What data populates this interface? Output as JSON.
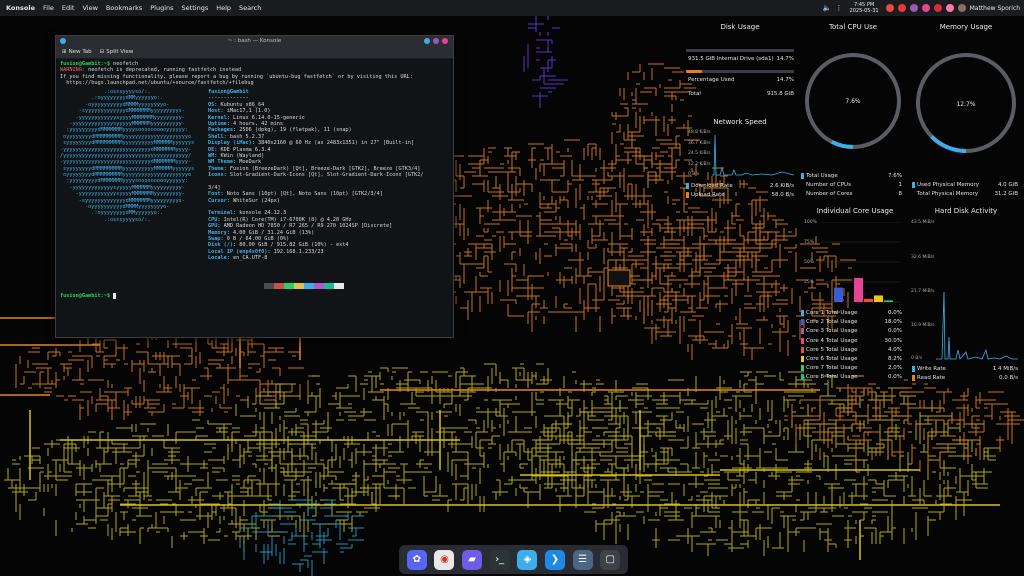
{
  "top_panel": {
    "menu": [
      "Konsole",
      "File",
      "Edit",
      "View",
      "Bookmarks",
      "Plugins",
      "Settings",
      "Help",
      "Search"
    ],
    "time": "7:45 PM",
    "date": "2025-05-31",
    "user": "Matthew Sporich"
  },
  "konsole": {
    "title": "~ : bash — Konsole",
    "new_tab": "New Tab",
    "split_view": "Split View",
    "lines": [
      {
        "cls": "green",
        "text": "fusion@Gambit:~$ ",
        "rest": "neofetch"
      },
      {
        "cls": "warn",
        "text": "WARNING: ",
        "rest": "neofetch is deprecated, running fastfetch instead"
      },
      {
        "cls": "dim",
        "text": "If you find missing functionality, please report a bug by running `ubuntu-bug fastfetch` or by visiting this URL:",
        "rest": ""
      },
      {
        "cls": "dim",
        "text": "  https://bugs.launchpad.net/ubuntu/+source/fastfetch/+filebug",
        "rest": ""
      }
    ],
    "logo": [
      "              .:osssyyyyso/:.",
      "          .:oyyyyyyyydMMyyyyyyo:.",
      "        -oyyyyyyyyyydMMMMyyyyyyyyo-",
      "      -syyyyyyyyyyyyydMMMMMMMyyyyyyyyys-",
      "     -yyyyyyyyyyyysyyyyMMMMMMMyyyyyyyyy-",
      "   -yyyyyyyyyyyyysyyyyyMMMMMMyyyyyyyyyy-",
      "  :yyyyyyyyydMMMMMMMyyyysoooooooooyyyyyy:",
      " oyyyyyyyydMMMMMMMMMyyyyyyyyyyyyyyyyyyyyyo",
      " syyyyyyyydMMMMMMMMMyyyyyyyyyyMMMMMMyyyyyys",
      "-yyyyyyyyyyyyyyyyyyyyyyyyyyyydMMMMMMMyyyy-",
      "/yyyyyyyyyyyyyyyyyyyyyyyyyyyyyyyyyyyyyyyy/",
      "-yyyyyyyyyyyyyyyyyyyyyyyyyyyydMMMMMMMyyyy-",
      " syyyyyyyydMMMMMMMMMyyyyyyyyyyMMMMMMyyyyyys",
      " oyyyyyyyydMMMMMMMMMyyyyyyyyyyyyyyyyyyyyyo",
      "  :yyyyyyyyydMMMMMMMyyyysoooooooooyyyyyy:",
      "   -yyyyyyyyyyyyysyyyyyMMMMMMyyyyyyyyyy-",
      "     -yyyyyyyyyyyysyyyyMMMMMMMyyyyyyyyy-",
      "      -syyyyyyyyyyyyydMMMMMMMyyyyyyyyys-",
      "        -oyyyyyyyyyydMMMMyyyyyyyyo-",
      "          .:oyyyyyyyydMMyyyyyyo:.",
      "              .:osssyyyyso/:."
    ],
    "host_line": "fusion@Gambit",
    "separator": "-------------",
    "info": [
      {
        "k": "OS",
        "v": "Kubuntu x86_64"
      },
      {
        "k": "Host",
        "v": "iMac17,1 (1.0)"
      },
      {
        "k": "Kernel",
        "v": "Linux 6.14.0-15-generic"
      },
      {
        "k": "Uptime",
        "v": "4 hours, 42 mins"
      },
      {
        "k": "Packages",
        "v": "2506 (dpkg), 19 (flatpak), 11 (snap)"
      },
      {
        "k": "Shell",
        "v": "bash 5.2.37"
      },
      {
        "k": "Display (iMac)",
        "v": "3840x2160 @ 60 Hz (as 2483x1351) in 27\" [Built-in]"
      },
      {
        "k": "DE",
        "v": "KDE Plasma 6.3.4"
      },
      {
        "k": "WM",
        "v": "KWin (Wayland)"
      },
      {
        "k": "WM Theme",
        "v": "MoeDark"
      },
      {
        "k": "Theme",
        "v": "Fusion (BreezeDark) [Qt], Breeze-Dark [GTK2], Breeze [GTK3/4]"
      },
      {
        "k": "Icons",
        "v": "Slot-Gradient-Dark-Icons [Qt], Slot-Gradient-Dark-Icons [GTK2/"
      },
      {
        "k": "",
        "v": "3/4]"
      },
      {
        "k": "Font",
        "v": "Noto Sans (10pt) [Qt], Noto Sans (10pt) [GTK2/3/4]"
      },
      {
        "k": "Cursor",
        "v": "WhiteSur (24px)"
      },
      {
        "k": "Terminal",
        "v": "konsole 24.12.3"
      },
      {
        "k": "CPU",
        "v": "Intel(R) Core(TM) i7-6700K (8) @ 4.20 GHz"
      },
      {
        "k": "GPU",
        "v": "AMD Radeon HD 7850 / R7 265 / R9 270 1024SP [Discrete]"
      },
      {
        "k": "Memory",
        "v": "4.00 GiB / 31.24 GiB (13%)"
      },
      {
        "k": "Swap",
        "v": "0 B / 64.00 GiB (0%)"
      },
      {
        "k": "Disk (/)",
        "v": "80.00 GiB / 915.82 GiB (10%) - ext4"
      },
      {
        "k": "Local IP (enp4s0f0)",
        "v": "192.168.1.233/23"
      },
      {
        "k": "Locale",
        "v": "en_CA.UTF-8"
      }
    ],
    "prompt": "fusion@Gambit:~$ ",
    "swatch_colors": [
      "#4d4d4d",
      "#c94f4f",
      "#2ecc71",
      "#e0c050",
      "#3daee9",
      "#b05cc6",
      "#1abc9c",
      "#e8e8e8"
    ]
  },
  "widgets": {
    "disk_usage": {
      "title": "Disk Usage",
      "rows": [
        {
          "label": "931.5 GiB Internal Drive (sda1)",
          "value": "14.7%"
        },
        {
          "label": "Percentage Used",
          "value": "14.7%"
        },
        {
          "label": "Total",
          "value": "915.8 GiB"
        }
      ],
      "fraction": 0.147
    },
    "network": {
      "title": "Network Speed",
      "axis": [
        "48.8 KiB/s",
        "36.7 KiB/s",
        "24.5 KiB/s",
        "12.2 KiB/s",
        "0 B/s"
      ],
      "download_label": "Download Rate",
      "download_value": "2.6 KiB/s",
      "upload_label": "Upload Rate",
      "upload_value": "58.0 B/s"
    },
    "cpu": {
      "title": "Total CPU Use",
      "value_text": "7.6%",
      "fraction": 0.076,
      "rows": [
        {
          "label": "Total Usage",
          "value": "7.6%"
        },
        {
          "label": "Number of CPUs",
          "value": "1"
        },
        {
          "label": "Number of Cores",
          "value": "8"
        }
      ]
    },
    "memory": {
      "title": "Memory Usage",
      "value_text": "12.7%",
      "fraction": 0.127,
      "rows": [
        {
          "label": "Used Physical Memory",
          "value": "4.0 GiB"
        },
        {
          "label": "Total Physical Memory",
          "value": "31.2 GiB"
        }
      ]
    },
    "cores": {
      "title": "Individual Core Usage",
      "axis": [
        "100%",
        "75%",
        "50%",
        "25%"
      ],
      "items": [
        {
          "label": "Core 1 Total Usage",
          "value": "0.0%",
          "color": "#3daee9",
          "pct": 0
        },
        {
          "label": "Core 2 Total Usage",
          "value": "18.0%",
          "color": "#3b5bdb",
          "pct": 18
        },
        {
          "label": "Core 3 Total Usage",
          "value": "0.0%",
          "color": "#9b59b6",
          "pct": 0
        },
        {
          "label": "Core 4 Total Usage",
          "value": "30.0%",
          "color": "#e84393",
          "pct": 30
        },
        {
          "label": "Core 5 Total Usage",
          "value": "4.0%",
          "color": "#e74c3c",
          "pct": 4
        },
        {
          "label": "Core 6 Total Usage",
          "value": "8.2%",
          "color": "#f1c40f",
          "pct": 8.2
        },
        {
          "label": "Core 7 Total Usage",
          "value": "2.0%",
          "color": "#2ecc71",
          "pct": 2
        },
        {
          "label": "Core 8 Total Usage",
          "value": "0.0%",
          "color": "#1abc9c",
          "pct": 0
        }
      ]
    },
    "hdd": {
      "title": "Hard Disk Activity",
      "axis": [
        "43.5 MiB/s",
        "32.6 MiB/s",
        "21.7 MiB/s",
        "10.9 MiB/s",
        "0 B/s"
      ],
      "write_label": "Write Rate",
      "write_value": "1.4 MiB/s",
      "read_label": "Read Rate",
      "read_value": "0.0 B/s"
    }
  },
  "dock": {
    "icons": [
      {
        "name": "app-launcher-icon",
        "color": "#5865f2",
        "glyph": "✿"
      },
      {
        "name": "chrome-icon",
        "color": "#e8e8e8",
        "glyph": "◉"
      },
      {
        "name": "dolphin-file-manager-icon",
        "color": "#6c5ce7",
        "glyph": "▰"
      },
      {
        "name": "konsole-terminal-icon",
        "color": "#2d3436",
        "glyph": "›_"
      },
      {
        "name": "discover-store-icon",
        "color": "#3daee9",
        "glyph": "◈"
      },
      {
        "name": "vscode-icon",
        "color": "#1e88e5",
        "glyph": "❯"
      },
      {
        "name": "system-settings-icon",
        "color": "#4b6584",
        "glyph": "☰"
      },
      {
        "name": "window-overview-icon",
        "color": "#3d4148",
        "glyph": "▢"
      }
    ]
  },
  "colors": {
    "accent": "#3daee9",
    "maze_orange": "#e8861d",
    "maze_yellow": "#d4c21a",
    "maze_blue": "#2aa8d8",
    "maze_purple": "#6a3de8"
  }
}
